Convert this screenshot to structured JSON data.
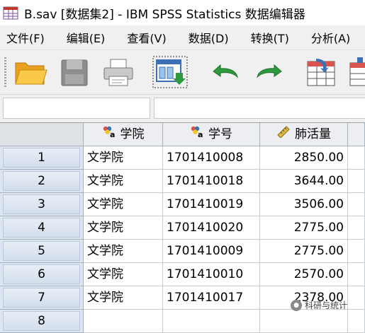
{
  "window": {
    "title": "B.sav [数据集2] - IBM SPSS Statistics 数据编辑器"
  },
  "menu": [
    "文件(F)",
    "编辑(E)",
    "查看(V)",
    "数据(D)",
    "转换(T)",
    "分析(A)"
  ],
  "toolbar": {
    "buttons": [
      "open-folder-icon",
      "save-icon",
      "print-icon",
      "recall-dialog-icon",
      "undo-icon",
      "redo-icon",
      "goto-case-icon",
      "goto-variable-icon"
    ]
  },
  "cell_editor": {
    "reference": "",
    "value": ""
  },
  "grid": {
    "columns": [
      {
        "label": "学院",
        "icon": "nominal-string-icon"
      },
      {
        "label": "学号",
        "icon": "nominal-string-icon"
      },
      {
        "label": "肺活量",
        "icon": "scale-ruler-icon"
      }
    ],
    "rows": [
      {
        "n": "1",
        "college": "文学院",
        "id": "1701410008",
        "lung": "2850.00"
      },
      {
        "n": "2",
        "college": "文学院",
        "id": "1701410018",
        "lung": "3644.00"
      },
      {
        "n": "3",
        "college": "文学院",
        "id": "1701410019",
        "lung": "3506.00"
      },
      {
        "n": "4",
        "college": "文学院",
        "id": "1701410020",
        "lung": "2775.00"
      },
      {
        "n": "5",
        "college": "文学院",
        "id": "1701410009",
        "lung": "2775.00"
      },
      {
        "n": "6",
        "college": "文学院",
        "id": "1701410010",
        "lung": "2570.00"
      },
      {
        "n": "7",
        "college": "文学院",
        "id": "1701410017",
        "lung": "2378.00"
      },
      {
        "n": "8",
        "college": "",
        "id": "",
        "lung": ""
      }
    ]
  },
  "watermark": {
    "text": "科研与统计"
  },
  "colors": {
    "rownum_bg": "#dce6f2",
    "header_bg": "#eceef1",
    "accent_green": "#2e9a3e"
  }
}
